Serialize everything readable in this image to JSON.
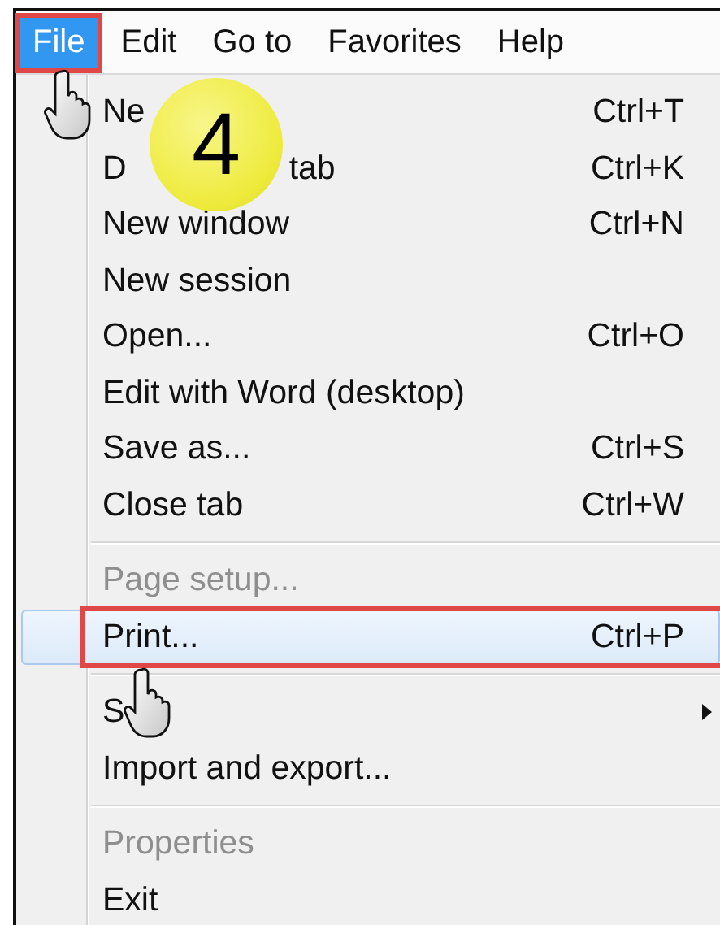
{
  "menu_bar": [
    {
      "label": "File",
      "selected": true,
      "callout": true
    },
    {
      "label": "Edit",
      "selected": false
    },
    {
      "label": "Go to",
      "selected": false
    },
    {
      "label": "Favorites",
      "selected": false
    },
    {
      "label": "Help",
      "selected": false
    }
  ],
  "menu": [
    {
      "kind": "item",
      "parts": [
        "Ne"
      ],
      "shortcut": "Ctrl+T",
      "disabled": false,
      "selected": false
    },
    {
      "kind": "item",
      "parts": [
        "D",
        "tab"
      ],
      "shortcut": "Ctrl+K",
      "disabled": false,
      "selected": false
    },
    {
      "kind": "item",
      "parts": [
        "New window"
      ],
      "shortcut": "Ctrl+N",
      "disabled": false,
      "selected": false
    },
    {
      "kind": "item",
      "parts": [
        "New session"
      ],
      "disabled": false,
      "selected": false
    },
    {
      "kind": "item",
      "parts": [
        "Open..."
      ],
      "shortcut": "Ctrl+O",
      "disabled": false,
      "selected": false
    },
    {
      "kind": "item",
      "parts": [
        "Edit with Word (desktop)"
      ],
      "disabled": false,
      "selected": false
    },
    {
      "kind": "item",
      "parts": [
        "Save as..."
      ],
      "shortcut": "Ctrl+S",
      "disabled": false,
      "selected": false
    },
    {
      "kind": "item",
      "parts": [
        "Close tab"
      ],
      "shortcut": "Ctrl+W",
      "disabled": false,
      "selected": false
    },
    {
      "kind": "separator"
    },
    {
      "kind": "item",
      "parts": [
        "Page setup..."
      ],
      "disabled": true,
      "selected": false
    },
    {
      "kind": "item",
      "parts": [
        "Print..."
      ],
      "shortcut": "Ctrl+P",
      "disabled": false,
      "selected": true,
      "callout": true
    },
    {
      "kind": "separator"
    },
    {
      "kind": "item",
      "parts": [
        "S"
      ],
      "disabled": false,
      "selected": false,
      "submenu": true
    },
    {
      "kind": "item",
      "parts": [
        "Import and export..."
      ],
      "disabled": false,
      "selected": false
    },
    {
      "kind": "separator"
    },
    {
      "kind": "item",
      "parts": [
        "Properties"
      ],
      "disabled": true,
      "selected": false
    },
    {
      "kind": "item",
      "parts": [
        "Exit"
      ],
      "disabled": false,
      "selected": false
    }
  ],
  "overlays": [
    {
      "kind": "badge",
      "text": "4"
    },
    {
      "kind": "cursor"
    },
    {
      "kind": "cursor"
    }
  ]
}
